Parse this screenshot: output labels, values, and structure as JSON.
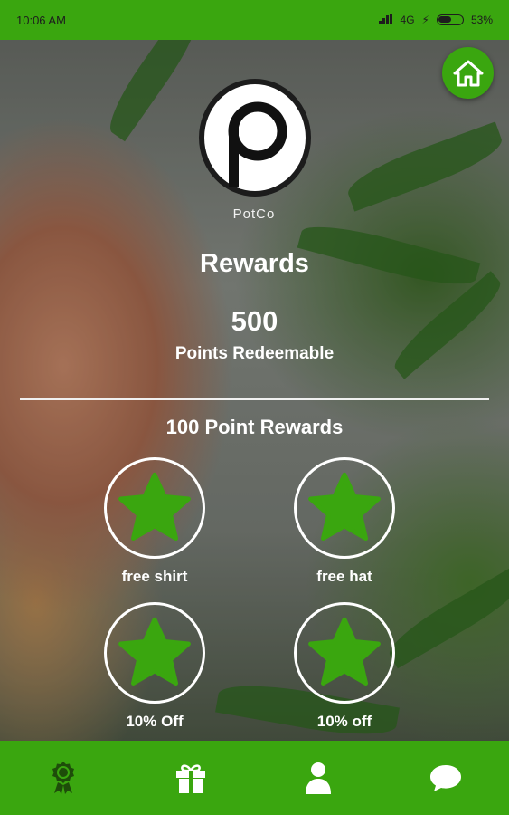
{
  "status_bar": {
    "time": "10:06 AM",
    "network": "4G",
    "battery": "53%"
  },
  "brand": {
    "name": "PotCo"
  },
  "page": {
    "title": "Rewards",
    "points": "500",
    "points_label": "Points Redeemable",
    "section_title": "100 Point Rewards"
  },
  "rewards": [
    {
      "label": "free shirt",
      "icon": "star-icon"
    },
    {
      "label": "free hat",
      "icon": "star-icon"
    },
    {
      "label": "10% Off",
      "icon": "star-icon"
    },
    {
      "label": "10% off",
      "icon": "star-icon"
    }
  ],
  "bottom_nav": [
    {
      "icon": "award-ribbon-icon",
      "active": true
    },
    {
      "icon": "gift-icon",
      "active": false
    },
    {
      "icon": "user-icon",
      "active": false
    },
    {
      "icon": "chat-bubble-icon",
      "active": false
    }
  ],
  "colors": {
    "brand_green": "#3aa60f",
    "star_green": "#3aa60f",
    "active_nav_icon": "#1e4d0a",
    "text": "#ffffff"
  }
}
